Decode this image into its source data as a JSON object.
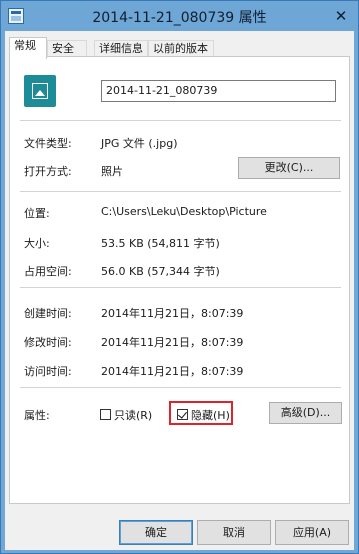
{
  "window": {
    "title": "2014-11-21_080739 属性",
    "icon": "properties-window-icon",
    "close_glyph": "✕"
  },
  "tabs": [
    {
      "label": "常规",
      "active": true
    },
    {
      "label": "安全",
      "active": false
    },
    {
      "label": "详细信息",
      "active": false
    },
    {
      "label": "以前的版本",
      "active": false
    }
  ],
  "general": {
    "file_icon": "image-file-icon",
    "file_name": "2014-11-21_080739",
    "type_label": "文件类型:",
    "type_value": "JPG 文件 (.jpg)",
    "open_with_label": "打开方式:",
    "open_with_value": "照片",
    "change_button": "更改(C)...",
    "location_label": "位置:",
    "location_value": "C:\\Users\\Leku\\Desktop\\Picture",
    "size_label": "大小:",
    "size_value": "53.5 KB (54,811 字节)",
    "size_on_disk_label": "占用空间:",
    "size_on_disk_value": "56.0 KB (57,344 字节)",
    "created_label": "创建时间:",
    "created_value": "2014年11月21日，8:07:39",
    "modified_label": "修改时间:",
    "modified_value": "2014年11月21日，8:07:39",
    "accessed_label": "访问时间:",
    "accessed_value": "2014年11月21日，8:07:39",
    "attributes_label": "属性:",
    "readonly_label": "只读(R)",
    "readonly_checked": false,
    "hidden_label": "隐藏(H)",
    "hidden_checked": true,
    "advanced_button": "高级(D)..."
  },
  "footer": {
    "ok": "确定",
    "cancel": "取消",
    "apply": "应用(A)"
  },
  "colors": {
    "titlebar": "#6ea6d5",
    "highlight_border": "#e0232b",
    "file_icon_bg": "#1e8c96"
  }
}
